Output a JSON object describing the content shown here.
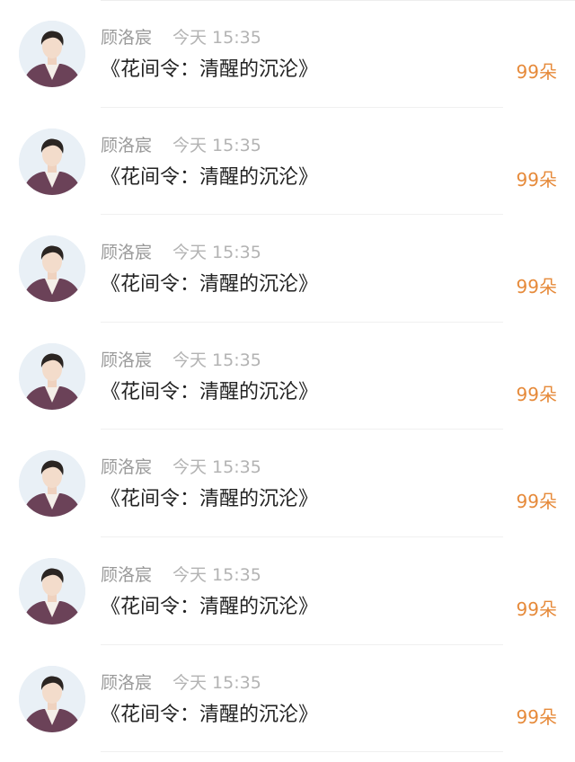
{
  "colors": {
    "name": "#9a9a9a",
    "time": "#b3b3b3",
    "title": "#222222",
    "count": "#e68a3a",
    "separator": "#f0f0f0"
  },
  "items": [
    {
      "avatar_icon": "user-avatar-photo",
      "name": "顾洛宸",
      "time": "今天 15:35",
      "title": "《花间令：清醒的沉沦》",
      "count": "99朵"
    },
    {
      "avatar_icon": "user-avatar-photo",
      "name": "顾洛宸",
      "time": "今天 15:35",
      "title": "《花间令：清醒的沉沦》",
      "count": "99朵"
    },
    {
      "avatar_icon": "user-avatar-photo",
      "name": "顾洛宸",
      "time": "今天 15:35",
      "title": "《花间令：清醒的沉沦》",
      "count": "99朵"
    },
    {
      "avatar_icon": "user-avatar-photo",
      "name": "顾洛宸",
      "time": "今天 15:35",
      "title": "《花间令：清醒的沉沦》",
      "count": "99朵"
    },
    {
      "avatar_icon": "user-avatar-photo",
      "name": "顾洛宸",
      "time": "今天 15:35",
      "title": "《花间令：清醒的沉沦》",
      "count": "99朵"
    },
    {
      "avatar_icon": "user-avatar-photo",
      "name": "顾洛宸",
      "time": "今天 15:35",
      "title": "《花间令：清醒的沉沦》",
      "count": "99朵"
    },
    {
      "avatar_icon": "user-avatar-photo",
      "name": "顾洛宸",
      "time": "今天 15:35",
      "title": "《花间令：清醒的沉沦》",
      "count": "99朵"
    }
  ]
}
